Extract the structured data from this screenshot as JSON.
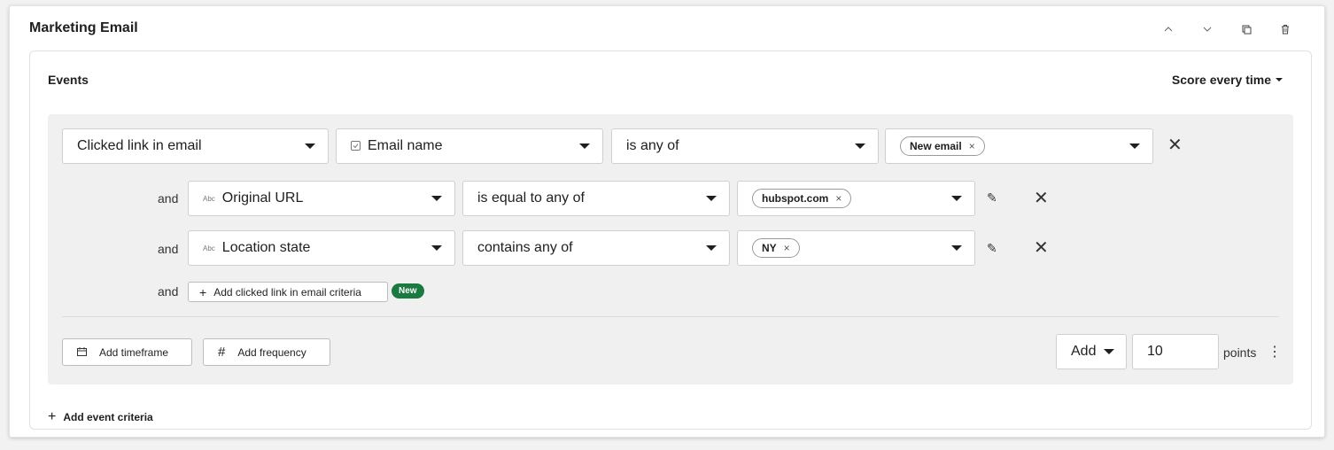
{
  "card": {
    "title": "Marketing Email"
  },
  "toolbar_icons": [
    "chevron-up-icon",
    "chevron-down-icon",
    "copy-icon",
    "trash-icon"
  ],
  "events": {
    "title": "Events",
    "score_mode": "Score every time",
    "event_select": "Clicked link in email",
    "property_select": "Email name",
    "operator_select": "is any of",
    "value_chip": "New email",
    "filters": [
      {
        "conjunction": "and",
        "type_prefix": "Abc",
        "property": "Original URL",
        "operator": "is equal to any of",
        "value": "hubspot.com"
      },
      {
        "conjunction": "and",
        "type_prefix": "Abc",
        "property": "Location state",
        "operator": "contains any of",
        "value": "NY"
      }
    ],
    "add_criteria": {
      "conjunction": "and",
      "label": "Add clicked link in email criteria",
      "badge": "New"
    },
    "add_timeframe": "Add timeframe",
    "add_frequency": "Add frequency",
    "action_select": "Add",
    "points_value": "10",
    "points_label": "points",
    "add_event_criteria": "Add event criteria"
  },
  "colors": {
    "accent_badge": "#1a7a3f",
    "panel_bg": "#f0f0f0"
  }
}
